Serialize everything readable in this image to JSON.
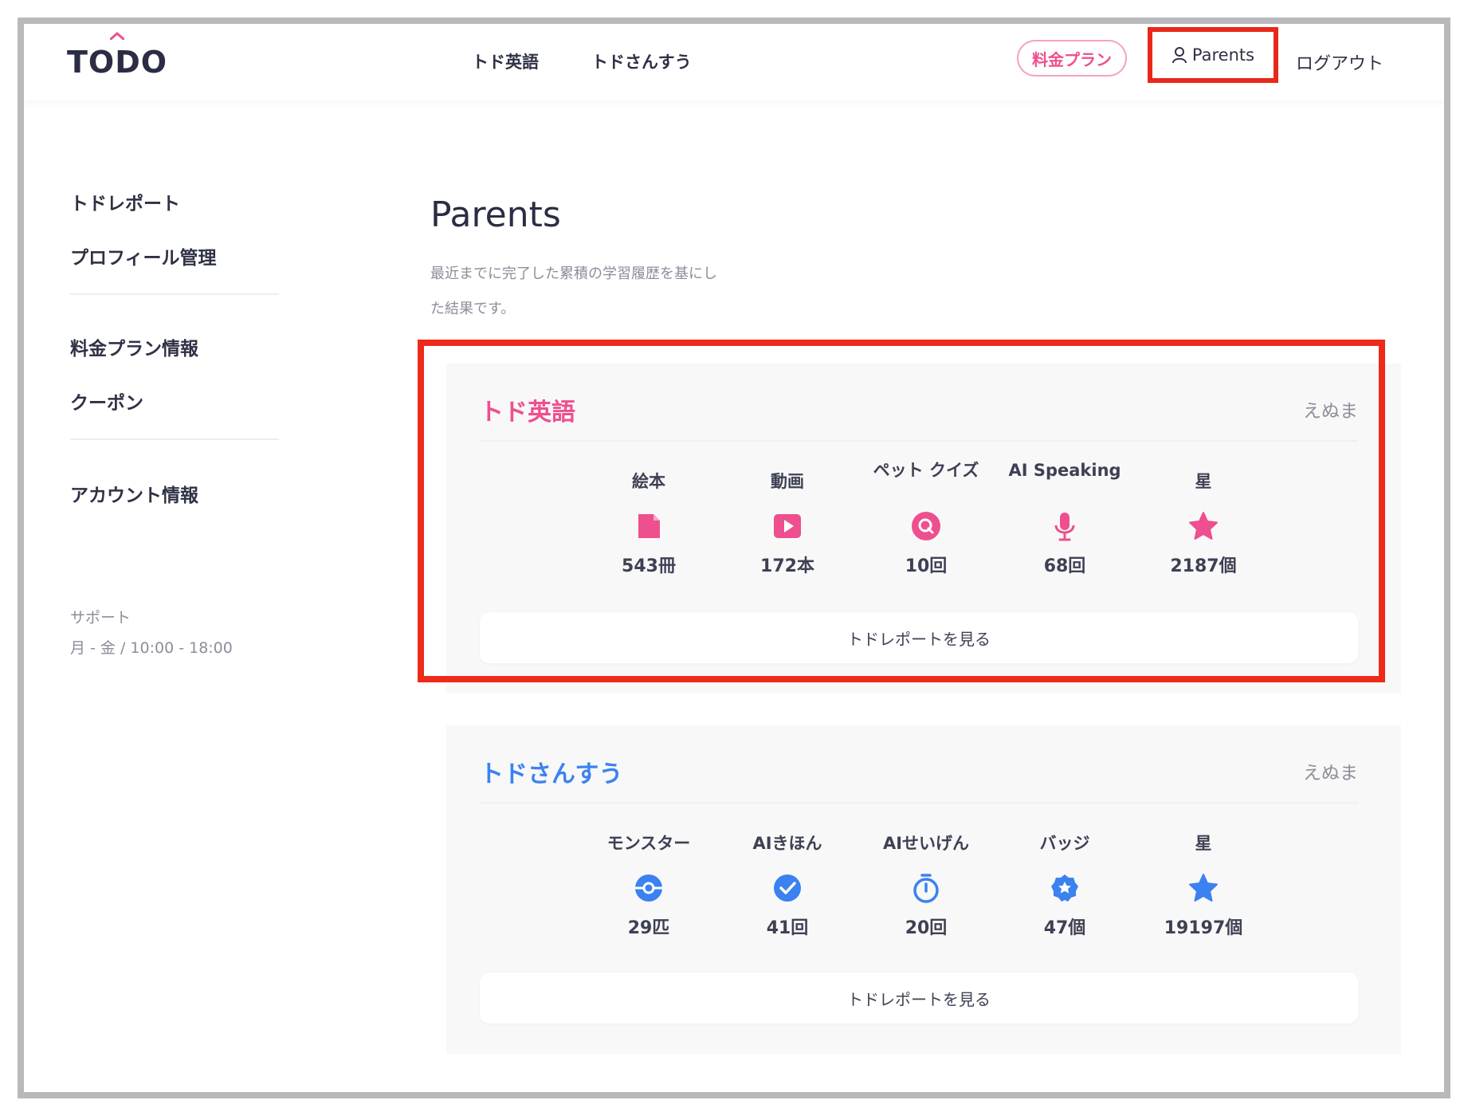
{
  "header": {
    "logo": "TODO",
    "nav": [
      "トド英語",
      "トドさんすう"
    ],
    "plan_button": "料金プラン",
    "parents_button": "Parents",
    "logout": "ログアウト"
  },
  "sidebar": {
    "items": [
      "トドレポート",
      "プロフィール管理",
      "料金プラン情報",
      "クーポン",
      "アカウント情報"
    ],
    "support_label": "サポート",
    "support_hours": "月 - 金 / 10:00 - 18:00"
  },
  "main": {
    "title": "Parents",
    "description": "最近までに完了した累積の学習履歴を基にした結果です。"
  },
  "cards": [
    {
      "title": "トド英語",
      "user": "えぬま",
      "accent": "#ee4f8e",
      "stats": [
        {
          "label": "絵本",
          "icon": "book-icon",
          "value": "543冊"
        },
        {
          "label": "動画",
          "icon": "video-play-icon",
          "value": "172本"
        },
        {
          "label": "ペット クイズ",
          "icon": "quiz-icon",
          "value": "10回"
        },
        {
          "label": "AI Speaking",
          "icon": "microphone-icon",
          "value": "68回"
        },
        {
          "label": "星",
          "icon": "star-icon",
          "value": "2187個"
        }
      ],
      "report_button": "トドレポートを見る"
    },
    {
      "title": "トドさんすう",
      "user": "えぬま",
      "accent": "#3b82f0",
      "stats": [
        {
          "label": "モンスター",
          "icon": "monster-ball-icon",
          "value": "29匹"
        },
        {
          "label": "AIきほん",
          "icon": "check-circle-icon",
          "value": "41回"
        },
        {
          "label": "AIせいげん",
          "icon": "stopwatch-icon",
          "value": "20回"
        },
        {
          "label": "バッジ",
          "icon": "badge-icon",
          "value": "47個"
        },
        {
          "label": "星",
          "icon": "star-icon",
          "value": "19197個"
        }
      ],
      "report_button": "トドレポートを見る"
    }
  ]
}
